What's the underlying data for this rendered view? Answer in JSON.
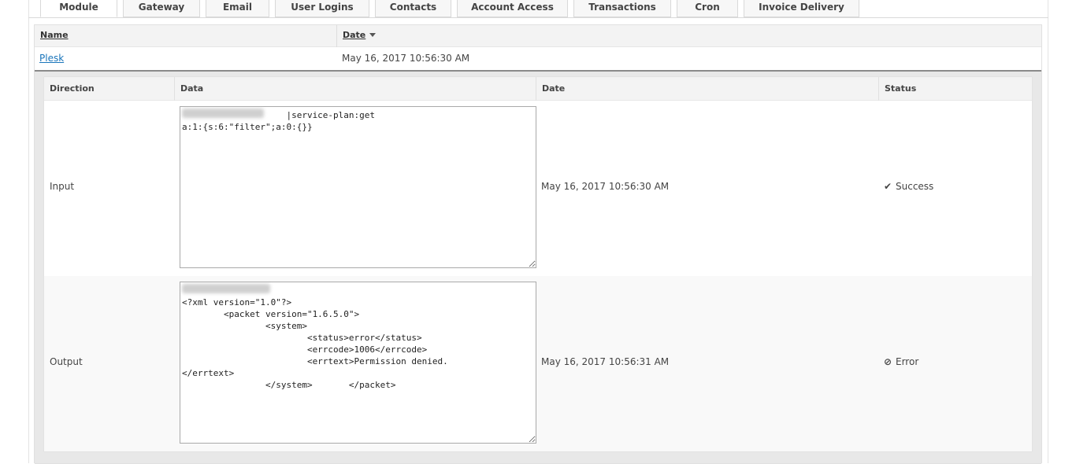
{
  "tabs": [
    {
      "label": "Module",
      "active": true
    },
    {
      "label": "Gateway",
      "active": false
    },
    {
      "label": "Email",
      "active": false
    },
    {
      "label": "User Logins",
      "active": false
    },
    {
      "label": "Contacts",
      "active": false
    },
    {
      "label": "Account Access",
      "active": false
    },
    {
      "label": "Transactions",
      "active": false
    },
    {
      "label": "Cron",
      "active": false
    },
    {
      "label": "Invoice Delivery",
      "active": false
    }
  ],
  "outer_table": {
    "col_name": "Name",
    "col_date": "Date",
    "row": {
      "name": "Plesk",
      "date": "May 16, 2017 10:56:30 AM"
    }
  },
  "detail_table": {
    "headers": {
      "direction": "Direction",
      "data": "Data",
      "date": "Date",
      "status": "Status"
    },
    "rows": [
      {
        "direction": "Input",
        "data": "                    |service-plan:get\na:1:{s:6:\"filter\";a:0:{}}",
        "date": "May 16, 2017 10:56:30 AM",
        "status": "Success",
        "status_icon": "check-icon"
      },
      {
        "direction": "Output",
        "data": "\n<?xml version=\"1.0\"?>\n        <packet version=\"1.6.5.0\">\n                <system>\n                        <status>error</status>\n                        <errcode>1006</errcode>\n                        <errtext>Permission denied.\n</errtext>\n                </system>       </packet>",
        "date": "May 16, 2017 10:56:31 AM",
        "status": "Error",
        "status_icon": "ban-icon"
      }
    ]
  }
}
